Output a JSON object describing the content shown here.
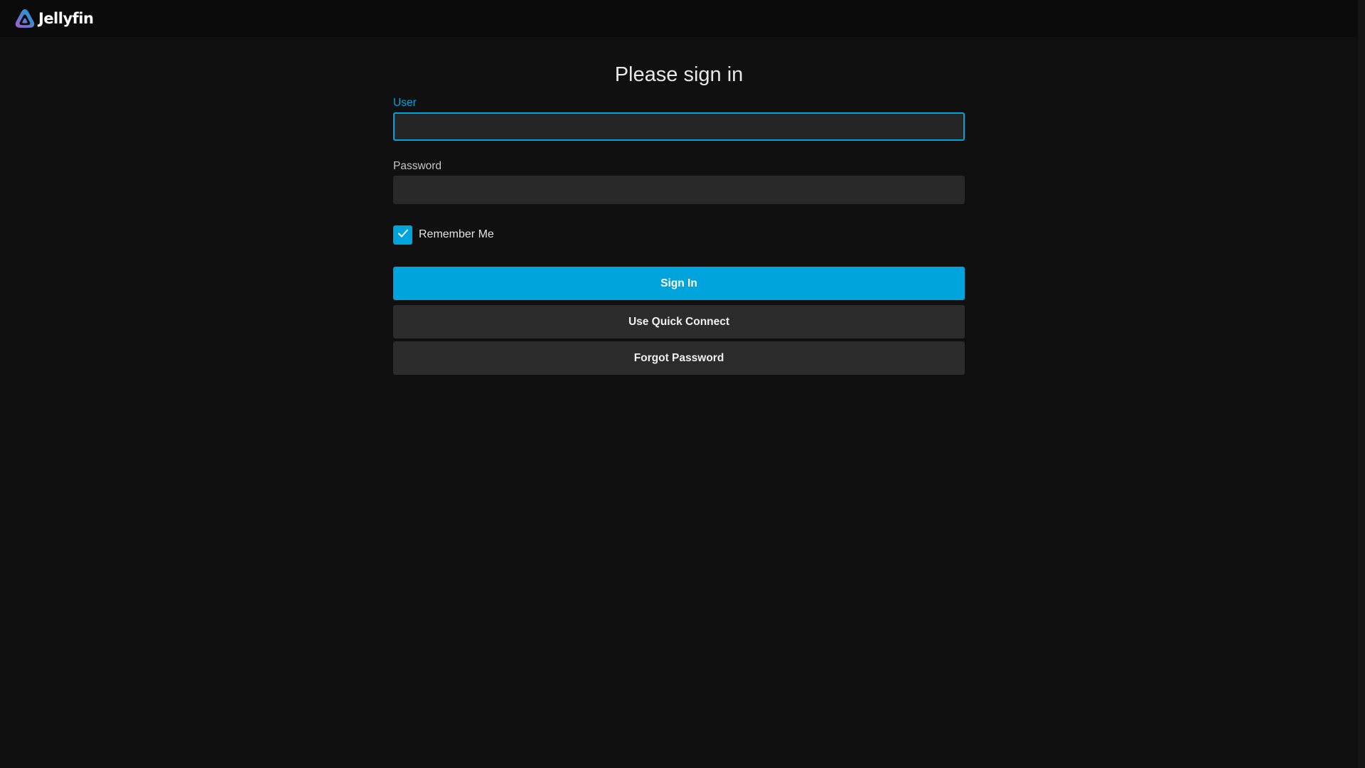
{
  "app": {
    "brand_name": "Jellyfin",
    "logo_icon": "jellyfin-logo-icon",
    "accent_color": "#00a4dc"
  },
  "login": {
    "title": "Please sign in",
    "user_label": "User",
    "user_value": "",
    "password_label": "Password",
    "password_value": "",
    "remember_label": "Remember Me",
    "remember_checked": true,
    "sign_in_label": "Sign In",
    "quick_connect_label": "Use Quick Connect",
    "forgot_password_label": "Forgot Password"
  }
}
